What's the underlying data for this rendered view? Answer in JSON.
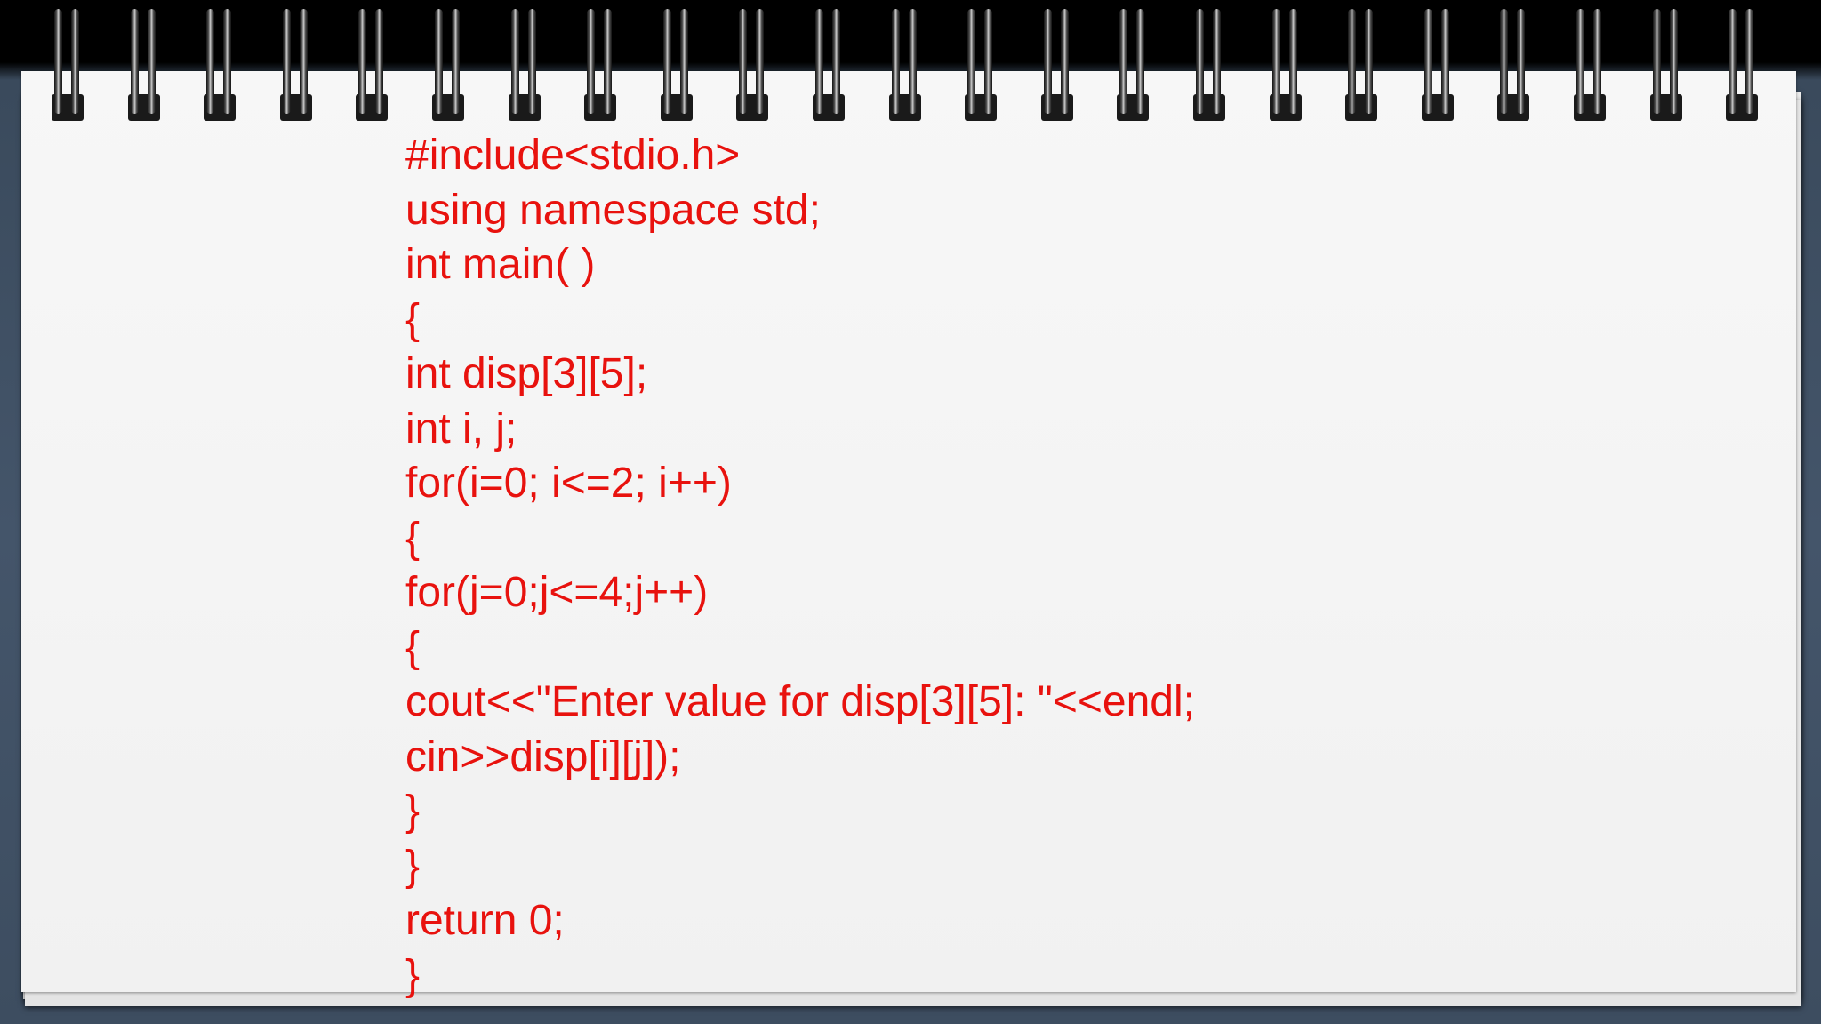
{
  "colors": {
    "code_text": "#e8120e",
    "paper": "#f5f5f5",
    "background": "#3f5064"
  },
  "icons": {
    "binding": "spiral-ring-icon"
  },
  "code": {
    "lines": [
      "#include<stdio.h>",
      "using namespace std;",
      "int main( )",
      "{",
      "int disp[3][5];",
      "int i, j;",
      "for(i=0; i<=2; i++)",
      "{",
      "for(j=0;j<=4;j++)",
      "{",
      "cout<<\"Enter value for disp[3][5]: \"<<endl;",
      "cin>>disp[i][j]);",
      "}",
      "}",
      "return 0;",
      "}"
    ]
  }
}
